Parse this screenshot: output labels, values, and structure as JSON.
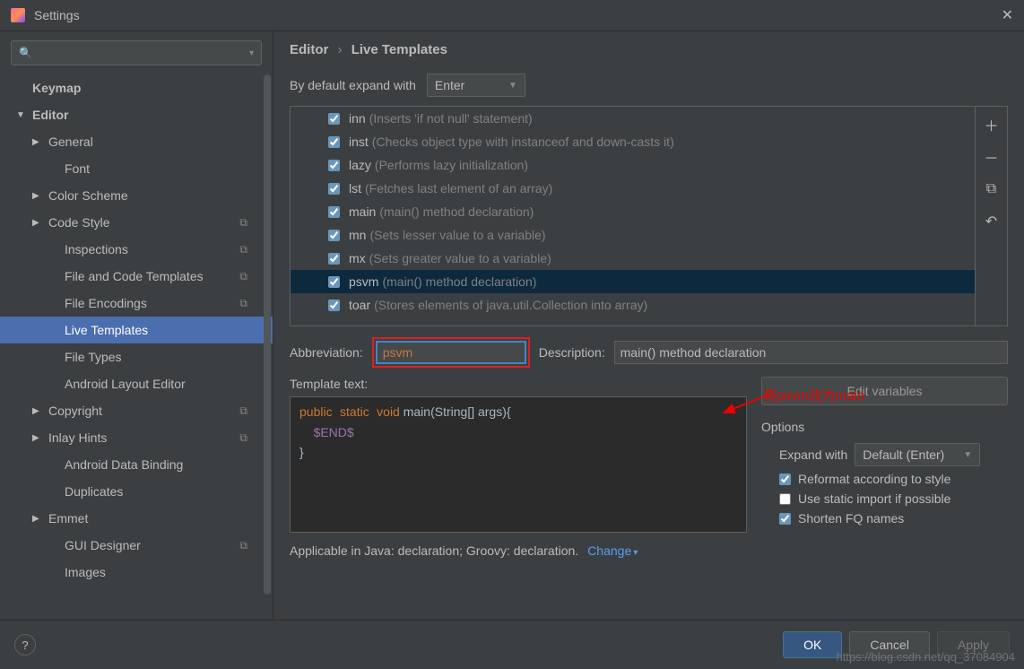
{
  "window": {
    "title": "Settings"
  },
  "sidebar": {
    "search_placeholder": "",
    "items": [
      {
        "label": "Keymap",
        "depth": 0,
        "arrow": "none",
        "bold": true
      },
      {
        "label": "Editor",
        "depth": 0,
        "arrow": "open",
        "bold": true
      },
      {
        "label": "General",
        "depth": 1,
        "arrow": "closed"
      },
      {
        "label": "Font",
        "depth": 2,
        "arrow": "none"
      },
      {
        "label": "Color Scheme",
        "depth": 1,
        "arrow": "closed"
      },
      {
        "label": "Code Style",
        "depth": 1,
        "arrow": "closed",
        "copy": true
      },
      {
        "label": "Inspections",
        "depth": 2,
        "arrow": "none",
        "copy": true
      },
      {
        "label": "File and Code Templates",
        "depth": 2,
        "arrow": "none",
        "copy": true
      },
      {
        "label": "File Encodings",
        "depth": 2,
        "arrow": "none",
        "copy": true
      },
      {
        "label": "Live Templates",
        "depth": 2,
        "arrow": "none",
        "selected": true
      },
      {
        "label": "File Types",
        "depth": 2,
        "arrow": "none"
      },
      {
        "label": "Android Layout Editor",
        "depth": 2,
        "arrow": "none"
      },
      {
        "label": "Copyright",
        "depth": 1,
        "arrow": "closed",
        "copy": true
      },
      {
        "label": "Inlay Hints",
        "depth": 1,
        "arrow": "closed",
        "copy": true
      },
      {
        "label": "Android Data Binding",
        "depth": 2,
        "arrow": "none"
      },
      {
        "label": "Duplicates",
        "depth": 2,
        "arrow": "none"
      },
      {
        "label": "Emmet",
        "depth": 1,
        "arrow": "closed"
      },
      {
        "label": "GUI Designer",
        "depth": 2,
        "arrow": "none",
        "copy": true
      },
      {
        "label": "Images",
        "depth": 2,
        "arrow": "none"
      }
    ]
  },
  "breadcrumb": {
    "a": "Editor",
    "b": "Live Templates"
  },
  "expand_label": "By default expand with",
  "expand_value": "Enter",
  "templates": [
    {
      "abbr": "inn",
      "desc": "(Inserts 'if not null' statement)"
    },
    {
      "abbr": "inst",
      "desc": "(Checks object type with instanceof and down-casts it)"
    },
    {
      "abbr": "lazy",
      "desc": "(Performs lazy initialization)"
    },
    {
      "abbr": "lst",
      "desc": "(Fetches last element of an array)"
    },
    {
      "abbr": "main",
      "desc": "(main() method declaration)"
    },
    {
      "abbr": "mn",
      "desc": "(Sets lesser value to a variable)"
    },
    {
      "abbr": "mx",
      "desc": "(Sets greater value to a variable)"
    },
    {
      "abbr": "psvm",
      "desc": "(main() method declaration)",
      "selected": true
    },
    {
      "abbr": "toar",
      "desc": "(Stores elements of java.util.Collection into array)"
    }
  ],
  "form": {
    "abbr_label": "Abbreviation:",
    "abbr_value": "psvm",
    "desc_label": "Description:",
    "desc_value": "main() method declaration",
    "template_label": "Template text:",
    "edit_vars": "Edit variables",
    "options_title": "Options",
    "expand_with_label": "Expand with",
    "expand_with_value": "Default (Enter)",
    "opt1": "Reformat according to style",
    "opt2": "Use static import if possible",
    "opt3": "Shorten FQ names",
    "applicable": "Applicable in Java: declaration; Groovy: declaration.",
    "change": "Change"
  },
  "code": {
    "kw_public": "public",
    "kw_static": "static",
    "kw_void": "void",
    "rest_line1": " main(String[] args){",
    "indent": "    ",
    "var_end": "$END$",
    "line3": "}"
  },
  "annotation_text": "将psvm改为main",
  "footer": {
    "ok": "OK",
    "cancel": "Cancel",
    "apply": "Apply"
  },
  "watermark": "https://blog.csdn.net/qq_37084904"
}
